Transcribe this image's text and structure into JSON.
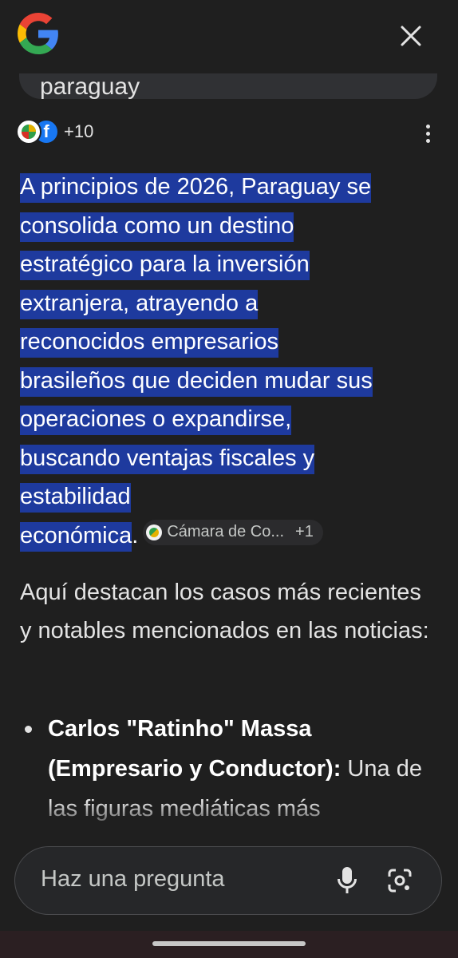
{
  "header": {
    "logo_icon": "google-g-icon",
    "close_icon": "close-icon"
  },
  "query": {
    "text": "paraguay"
  },
  "sources": {
    "icons": [
      "camara-comercio-icon",
      "facebook-icon"
    ],
    "facebook_letter": "f",
    "count": "+10",
    "more_icon": "more-vert-icon"
  },
  "answer": {
    "highlighted_lines": [
      " A principios de 2026, Paraguay se",
      "consolida como un destino",
      "estratégico para la inversión",
      "extranjera, atrayendo a",
      "reconocidos empresarios",
      "brasileños que deciden mudar sus",
      "operaciones o expandirse,",
      "buscando ventajas fiscales y",
      "estabilidad",
      "económica"
    ],
    "end_punct": ".",
    "citation_chip": {
      "label": "Cámara de Co...",
      "count": "+1"
    },
    "intro_text": "Aquí destacan los casos más recientes y notables mencionados en las noticias:",
    "bullet": {
      "title": "Carlos \"Ratinho\" Massa (Empresario y Conductor):",
      "text": " Una de las figuras mediáticas más"
    }
  },
  "ask_bar": {
    "placeholder": "Haz una pregunta",
    "mic_icon": "mic-icon",
    "lens_icon": "lens-search-icon"
  },
  "colors": {
    "background": "#1f1f1f",
    "highlight": "#1e3a9e",
    "text": "#e3e3e3"
  }
}
